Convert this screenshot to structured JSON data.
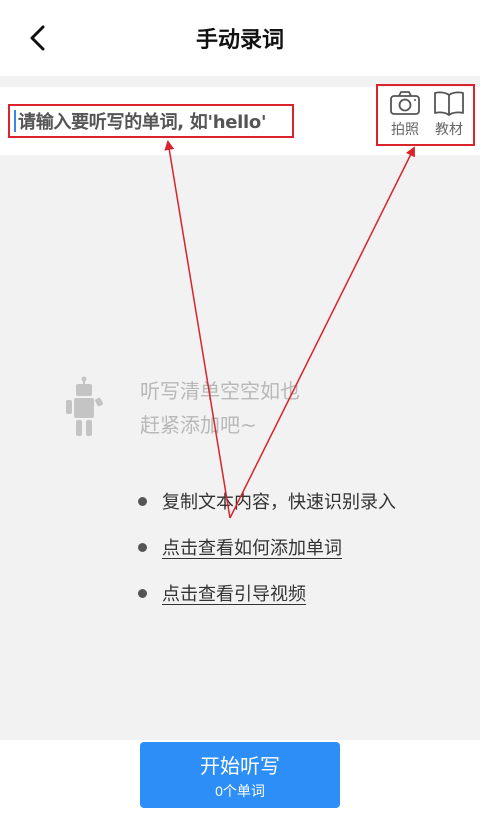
{
  "header": {
    "title": "手动录词",
    "back_icon": "chevron-left-icon"
  },
  "input": {
    "placeholder": "请输入要听写的单词, 如'hello'"
  },
  "tools": {
    "photo_label": "拍照",
    "photo_icon": "camera-icon",
    "textbook_label": "教材",
    "textbook_icon": "book-icon"
  },
  "empty_state": {
    "icon": "robot-icon",
    "line1": "听写清单空空如也",
    "line2": "赶紧添加吧~"
  },
  "tips": {
    "tip1": "复制文本内容，快速识别录入",
    "tip2": "点击查看如何添加单词",
    "tip3": "点击查看引导视频"
  },
  "start_button": {
    "label": "开始听写",
    "count": "0个单词"
  },
  "colors": {
    "accent": "#2e8ef7",
    "annotation_red": "#d9232d"
  }
}
